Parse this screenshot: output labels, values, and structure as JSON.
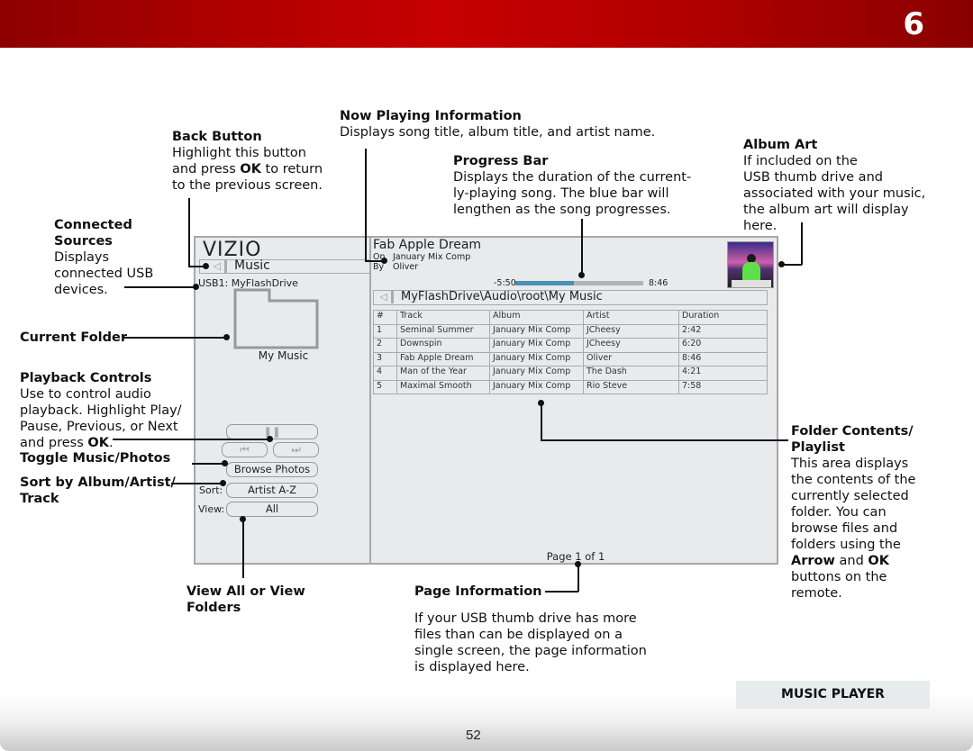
{
  "chapter_number": "6",
  "page_number": "52",
  "section_label": "MUSIC PLAYER",
  "annotations": {
    "now_playing": {
      "title": "Now Playing Information",
      "body": "Displays song title, album title, and artist name."
    },
    "back_button": {
      "title": "Back Button",
      "body_lines": [
        "Highlight this button",
        "and press ",
        "OK",
        " to return",
        "to the previous screen."
      ]
    },
    "progress_bar": {
      "title": "Progress Bar",
      "body_lines": [
        "Displays the duration of the current-",
        "ly-playing song. The blue bar will",
        "lengthen as the song progresses."
      ]
    },
    "album_art": {
      "title": "Album Art",
      "body_lines": [
        "If included on the",
        "USB thumb drive and",
        "associated with your music,",
        "the album art will display",
        "here."
      ]
    },
    "connected_sources": {
      "title_lines": [
        "Connected",
        "Sources"
      ],
      "body_lines": [
        "Displays",
        "connected USB",
        "devices."
      ]
    },
    "current_folder": {
      "title": "Current Folder"
    },
    "playback_controls": {
      "title": "Playback Controls",
      "body_lines": [
        "Use to control audio",
        "playback. Highlight Play/",
        "Pause, Previous, or Next",
        "and press "
      ],
      "ok": "OK",
      "end": "."
    },
    "toggle": {
      "title": "Toggle Music/Photos"
    },
    "sort": {
      "title_lines": [
        "Sort by Album/Artist/",
        "Track"
      ]
    },
    "view": {
      "title_lines": [
        "View All or View",
        "Folders"
      ]
    },
    "page_info": {
      "title": "Page Information",
      "body_lines": [
        "If your USB thumb drive has more",
        "files than can be displayed on a",
        "single screen, the page information",
        "is displayed here."
      ]
    },
    "folder_contents": {
      "title_lines": [
        "Folder Contents/",
        "Playlist"
      ],
      "body_lines": [
        "This area displays",
        "the contents of the",
        "currently selected",
        "folder. You can",
        "browse files and",
        "folders using the"
      ],
      "arrow": "Arrow",
      "and": " and ",
      "ok": "OK",
      "tail_lines": [
        "buttons on the",
        "remote."
      ]
    }
  },
  "tv": {
    "logo": "VIZIO",
    "back_glyph": "◁",
    "section_title": "Music",
    "usb_source": "USB1: MyFlashDrive",
    "folder_name": "My Music",
    "controls": {
      "play_pause_glyph": "❚❚",
      "previous_glyph": "⏮",
      "next_glyph": "⏭",
      "browse_label": "Browse Photos",
      "sort_label": "Sort:",
      "sort_value": "Artist A-Z",
      "view_label": "View:",
      "view_value": "All"
    },
    "now_playing": {
      "title": "Fab Apple Dream",
      "album_prefix": "On",
      "album": "January Mix Comp",
      "artist_prefix": "By",
      "artist": "Oliver",
      "time_remaining": "-5:50",
      "time_total": "8:46",
      "progress_fraction": 0.46
    },
    "path": "MyFlashDrive\\Audio\\root\\My Music",
    "table": {
      "headers": [
        "#",
        "Track",
        "Album",
        "Artist",
        "Duration"
      ],
      "rows": [
        [
          "1",
          "Seminal Summer",
          "January Mix Comp",
          "JCheesy",
          "2:42"
        ],
        [
          "2",
          "Downspin",
          "January Mix Comp",
          "JCheesy",
          "6:20"
        ],
        [
          "3",
          "Fab Apple Dream",
          "January Mix Comp",
          "Oliver",
          "8:46"
        ],
        [
          "4",
          "Man of the Year",
          "January Mix Comp",
          "The Dash",
          "4:21"
        ],
        [
          "5",
          "Maximal Smooth",
          "January Mix Comp",
          "Rio Steve",
          "7:58"
        ]
      ]
    },
    "page_info": "Page 1 of 1"
  }
}
